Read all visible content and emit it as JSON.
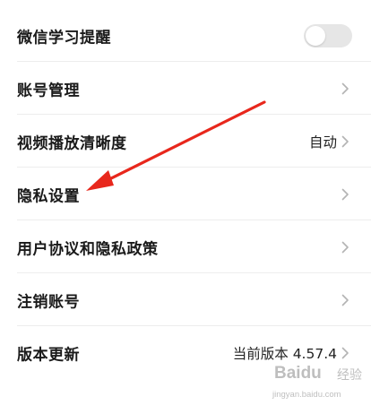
{
  "settings": {
    "wechat_reminder": {
      "label": "微信学习提醒",
      "toggle_on": false
    },
    "account_management": {
      "label": "账号管理"
    },
    "video_quality": {
      "label": "视频播放清晰度",
      "value": "自动"
    },
    "privacy_settings": {
      "label": "隐私设置"
    },
    "user_agreement": {
      "label": "用户协议和隐私政策"
    },
    "cancel_account": {
      "label": "注销账号"
    },
    "version_update": {
      "label": "版本更新",
      "value": "当前版本 4.57.4"
    }
  },
  "annotation": {
    "arrow_color": "#e8271c",
    "icon": "red-arrow-pointing-left"
  },
  "watermark": {
    "brand": "Baidu",
    "sub": "经验",
    "url": "jingyan.baidu.com"
  },
  "colors": {
    "toggle_off": "#e6e6e6",
    "divider": "#ededed",
    "chevron": "#b3b3b3"
  }
}
